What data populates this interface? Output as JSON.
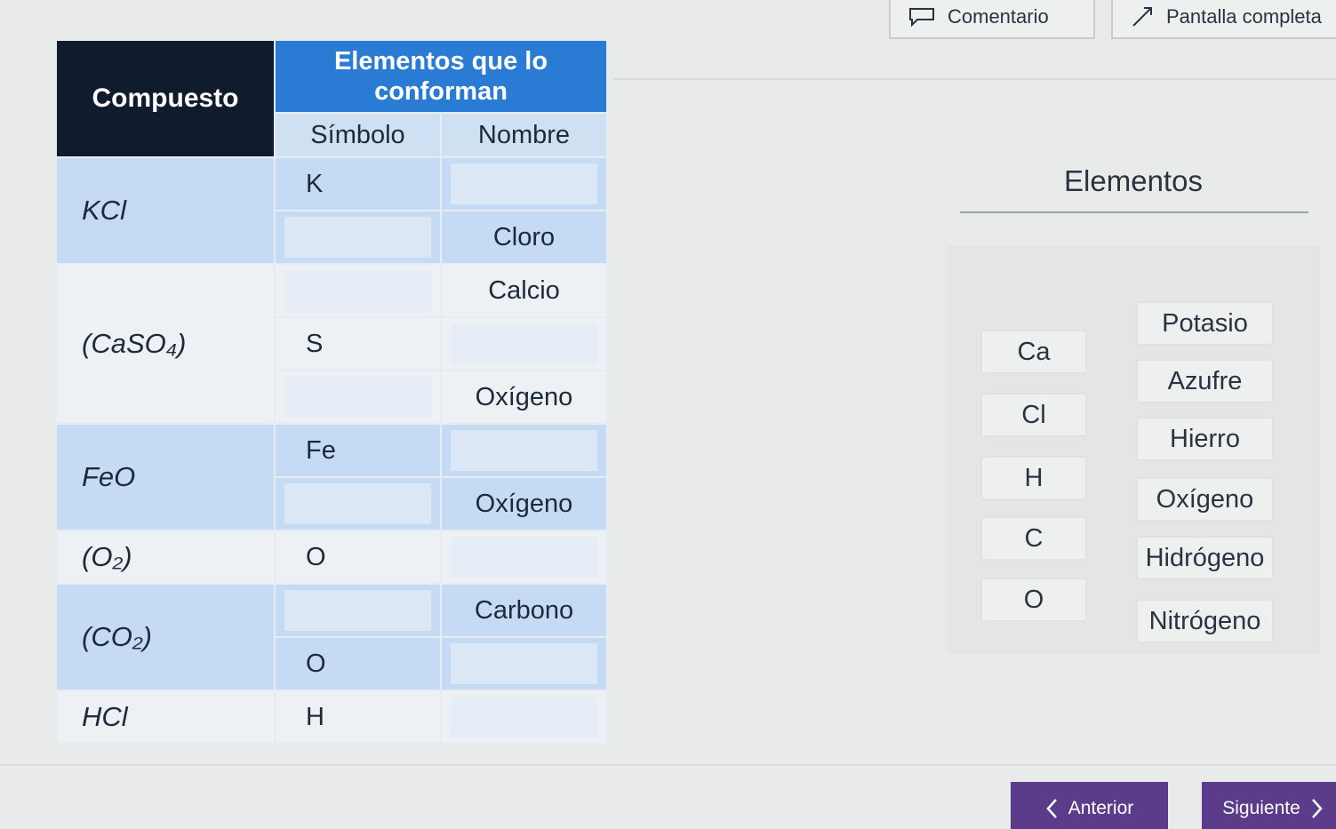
{
  "topbar": {
    "comment_label": "Comentario",
    "fullscreen_label": "Pantalla completa"
  },
  "table": {
    "header_compound": "Compuesto",
    "header_elements": "Elementos que lo conforman",
    "header_symbol": "Símbolo",
    "header_name": "Nombre",
    "rows": [
      {
        "compound": "KCl",
        "symbol": "K",
        "name": ""
      },
      {
        "compound": "",
        "symbol": "",
        "name": "Cloro"
      },
      {
        "compound": "",
        "symbol": "",
        "name": "Calcio"
      },
      {
        "compound": "(CaSO₄)",
        "symbol": "S",
        "name": ""
      },
      {
        "compound": "",
        "symbol": "",
        "name": "Oxígeno"
      },
      {
        "compound": "FeO",
        "symbol": "Fe",
        "name": ""
      },
      {
        "compound": "",
        "symbol": "",
        "name": "Oxígeno"
      },
      {
        "compound": "(O₂)",
        "symbol": "O",
        "name": ""
      },
      {
        "compound": "(CO₂)",
        "symbol": "",
        "name": "Carbono"
      },
      {
        "compound": "",
        "symbol": "O",
        "name": ""
      },
      {
        "compound": "HCl",
        "symbol": "H",
        "name": ""
      }
    ]
  },
  "bank": {
    "title": "Elementos",
    "symbols": [
      "Ca",
      "Cl",
      "H",
      "C",
      "O"
    ],
    "names": [
      "Potasio",
      "Azufre",
      "Hierro",
      "Oxígeno",
      "Hidrógeno",
      "Nitrógeno"
    ]
  },
  "nav": {
    "prev_label": "Anterior",
    "next_label": "Siguiente"
  }
}
